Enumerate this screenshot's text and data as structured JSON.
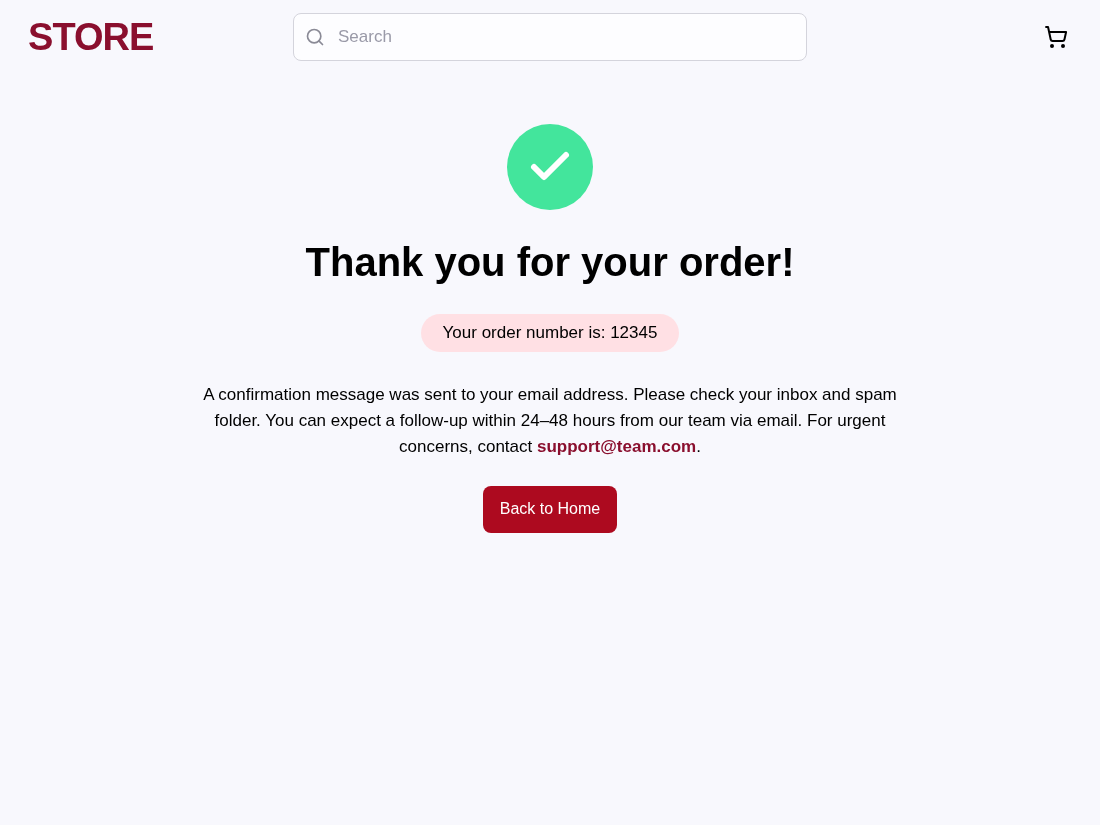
{
  "header": {
    "logo": "STORE",
    "search": {
      "placeholder": "Search"
    }
  },
  "confirmation": {
    "title": "Thank you for your order!",
    "order_number": "Your order number is: 12345",
    "message": {
      "text": "A confirmation message was sent to your email address. Please check your inbox and spam folder. You can expect a follow-up within 24–48 hours from our team via email. For urgent concerns, contact ",
      "link": "support@team.com",
      "after": "."
    },
    "button": "Back to Home"
  }
}
